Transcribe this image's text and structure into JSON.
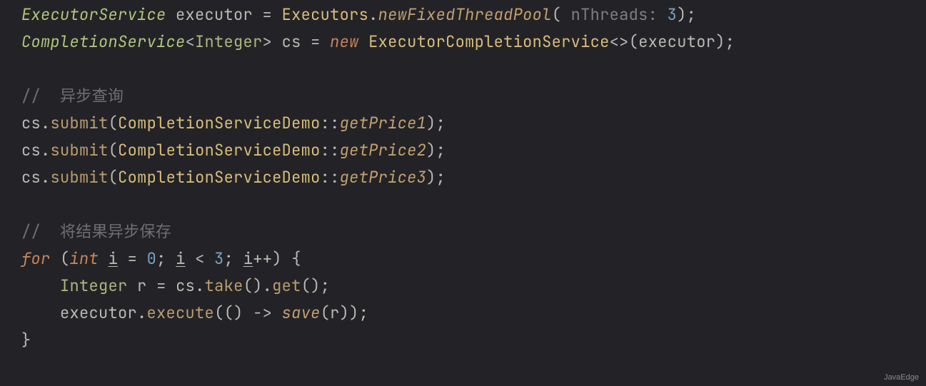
{
  "code": {
    "line1": {
      "type1": "ExecutorService",
      "var": "executor",
      "eq": " = ",
      "class": "Executors",
      "dot": ".",
      "method": "newFixedThreadPool",
      "lp": "(",
      "hint": " nThreads: ",
      "num": "3",
      "rp": ")",
      "semi": ";"
    },
    "line2": {
      "type1": "CompletionService",
      "lt": "<",
      "gen": "Integer",
      "gt": ">",
      "var": "cs",
      "eq": " = ",
      "kw": "new",
      "sp": " ",
      "class": "ExecutorCompletionService",
      "diamond": "<>",
      "lp": "(",
      "arg": "executor",
      "rp": ")",
      "semi": ";"
    },
    "comment1": "//  异步查询",
    "submit": {
      "obj": "cs",
      "dot": ".",
      "method": "submit",
      "lp": "(",
      "cls": "CompletionServiceDemo",
      "cc": "::",
      "m1": "getPrice1",
      "m2": "getPrice2",
      "m3": "getPrice3",
      "rp": ")",
      "semi": ";"
    },
    "comment2": "//  将结果异步保存",
    "for": {
      "kw_for": "for",
      "lp": " (",
      "kw_int": "int",
      "sp": " ",
      "i1": "i",
      "eq": " = ",
      "zero": "0",
      "semi1": "; ",
      "i2": "i",
      "lt": " < ",
      "three": "3",
      "semi2": "; ",
      "i3": "i",
      "pp": "++",
      "rp": ") ",
      "lb": "{"
    },
    "body1": {
      "indent": "    ",
      "type": "Integer",
      "sp": " ",
      "var": "r",
      "eq": " = ",
      "obj": "cs",
      "dot1": ".",
      "m1": "take",
      "p1": "()",
      "dot2": ".",
      "m2": "get",
      "p2": "()",
      "semi": ";"
    },
    "body2": {
      "indent": "    ",
      "obj": "executor",
      "dot": ".",
      "m": "execute",
      "lp": "(",
      "lambda_lp": "()",
      "arrow": " -> ",
      "fn": "save",
      "lp2": "(",
      "arg": "r",
      "rp2": ")",
      "rp": ")",
      "semi": ";"
    },
    "close": "}"
  },
  "watermark": "JavaEdge"
}
